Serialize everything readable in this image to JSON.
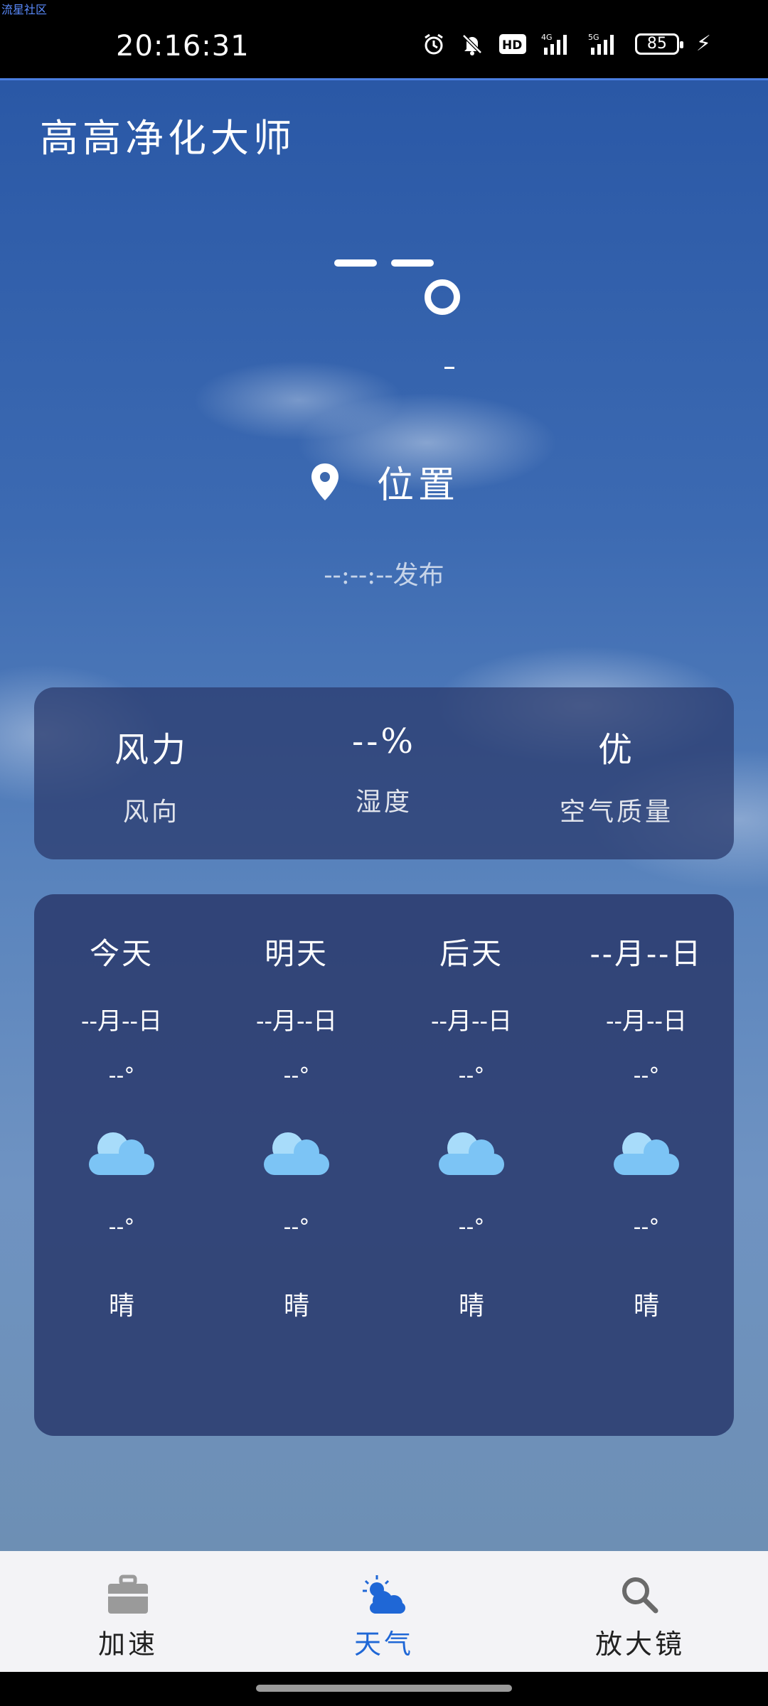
{
  "status_bar": {
    "corner_tag": "流星社区",
    "time": "20:16:31",
    "battery": "85"
  },
  "app": {
    "title": "高高净化大师"
  },
  "current": {
    "location": "位置",
    "publish_time": "--:--:--发布"
  },
  "metrics": [
    {
      "value": "风力",
      "label": "风向"
    },
    {
      "value": "--%",
      "label": "湿度"
    },
    {
      "value": "优",
      "label": "空气质量"
    }
  ],
  "forecast": [
    {
      "name": "今天",
      "date": "--月--日",
      "high": "--°",
      "low": "--°",
      "condition": "晴",
      "icon": "cloud-icon"
    },
    {
      "name": "明天",
      "date": "--月--日",
      "high": "--°",
      "low": "--°",
      "condition": "晴",
      "icon": "cloud-icon"
    },
    {
      "name": "后天",
      "date": "--月--日",
      "high": "--°",
      "low": "--°",
      "condition": "晴",
      "icon": "cloud-icon"
    },
    {
      "name": "--月--日",
      "date": "--月--日",
      "high": "--°",
      "low": "--°",
      "condition": "晴",
      "icon": "cloud-icon"
    }
  ],
  "nav": [
    {
      "label": "加速",
      "icon": "toolbox-icon",
      "active": false
    },
    {
      "label": "天气",
      "icon": "weather-icon",
      "active": true
    },
    {
      "label": "放大镜",
      "icon": "magnifier-icon",
      "active": false
    }
  ],
  "colors": {
    "accent": "#1f67d6",
    "card": "#2b3b6e",
    "cloud": "#7cc4f5"
  }
}
